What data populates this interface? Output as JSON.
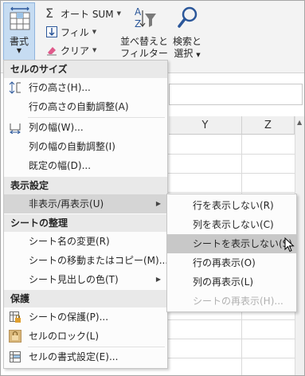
{
  "ribbon": {
    "format_label": "書式",
    "autosum_label": "オート SUM",
    "fill_label": "フィル",
    "clear_label": "クリア",
    "sort_filter_line1": "並べ替えと",
    "sort_filter_line2": "フィルター",
    "find_select_line1": "検索と",
    "find_select_line2": "選択"
  },
  "columns": [
    "Y",
    "Z"
  ],
  "format_menu": {
    "sections": {
      "cell_size": "セルのサイズ",
      "visibility": "表示設定",
      "organize_sheets": "シートの整理",
      "protection": "保護"
    },
    "items": {
      "row_height": "行の高さ(H)...",
      "autofit_row_height": "行の高さの自動調整(A)",
      "column_width": "列の幅(W)...",
      "autofit_column_width": "列の幅の自動調整(I)",
      "default_width": "既定の幅(D)...",
      "hide_unhide": "非表示/再表示(U)",
      "rename_sheet": "シート名の変更(R)",
      "move_copy_sheet": "シートの移動またはコピー(M)...",
      "tab_color": "シート見出しの色(T)",
      "protect_sheet": "シートの保護(P)...",
      "lock_cell": "セルのロック(L)",
      "format_cells": "セルの書式設定(E)..."
    }
  },
  "hide_submenu": {
    "items": [
      {
        "label": "行を表示しない(R)",
        "state": "normal"
      },
      {
        "label": "列を表示しない(C)",
        "state": "normal"
      },
      {
        "label": "シートを表示しない(S)",
        "state": "hover"
      },
      {
        "label": "行の再表示(O)",
        "state": "normal"
      },
      {
        "label": "列の再表示(L)",
        "state": "normal"
      },
      {
        "label": "シートの再表示(H)...",
        "state": "disabled"
      }
    ]
  },
  "colors": {
    "accent": "#2b579a",
    "active_item": "#d5d5d5",
    "hover_item": "#c8c8c8",
    "section_header": "#e9e9e9"
  }
}
